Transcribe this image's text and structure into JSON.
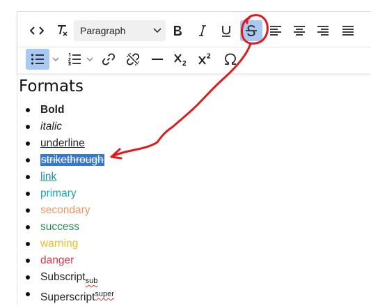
{
  "toolbar": {
    "block_format": "Paragraph",
    "row1_buttons": [
      "source-code",
      "clear-formatting",
      "bold",
      "italic",
      "underline",
      "strikethrough",
      "align-left",
      "align-center",
      "align-right",
      "justify"
    ],
    "row2_buttons": [
      "bullet-list",
      "numbered-list",
      "link",
      "unlink",
      "horizontal-line",
      "subscript",
      "superscript",
      "special-character"
    ],
    "active_buttons": [
      "strikethrough",
      "bullet-list"
    ],
    "active_color": "#a9c9f3"
  },
  "content": {
    "heading": "Formats",
    "items": [
      {
        "text": "Bold"
      },
      {
        "text": "italic"
      },
      {
        "text": "underline"
      },
      {
        "text": "strikethrough"
      },
      {
        "text": "link"
      },
      {
        "text": "primary",
        "color": "#1aa3b3"
      },
      {
        "text": "secondary",
        "color": "#f0955f"
      },
      {
        "text": "success",
        "color": "#258754"
      },
      {
        "text": "warning",
        "color": "#f2bc1e"
      },
      {
        "text": "danger",
        "color": "#dc3545"
      },
      {
        "text": "Subscript",
        "sub": "sub"
      },
      {
        "text": "Superscript",
        "sup": "super"
      }
    ]
  },
  "annotation": {
    "color": "#e0191b"
  }
}
